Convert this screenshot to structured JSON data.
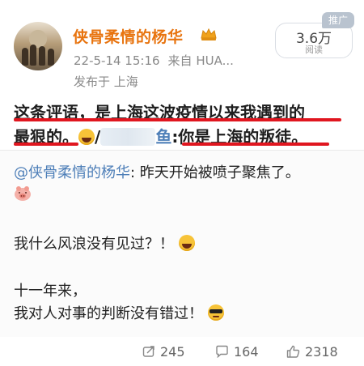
{
  "post": {
    "username": "侠骨柔情的杨华",
    "timestamp": "22-5-14 15:16",
    "source_prefix": "来自",
    "source": "HUA...",
    "location": "发布于 上海",
    "reads_count": "3.6万",
    "reads_label": "阅读",
    "ad_badge": "推广",
    "text_line1": "这条评语，是上海这波疫情以来我遇到的",
    "text_line2a": "最狠的。",
    "text_line2b": "/",
    "text_line2c": "鱼",
    "text_line2d": ":你是上海的叛徒。",
    "reply_mention": "@侠骨柔情的杨华",
    "reply_text": ": 昨天开始被喷子聚焦了。",
    "para1": "我什么风浪没有见过？！",
    "para2": "十一年来，",
    "para3": "我对人对事的判断没有错过！"
  },
  "actions": {
    "share_count": "245",
    "comment_count": "164",
    "like_count": "2318"
  },
  "colors": {
    "username": "#e8740f",
    "underline": "#e0161f",
    "link": "#4e7fb8"
  },
  "icons": [
    "share-icon",
    "comment-icon",
    "like-icon",
    "vip-crown-icon",
    "laugh-emoji-icon",
    "cool-emoji-icon",
    "pig-face-emoji-icon"
  ]
}
